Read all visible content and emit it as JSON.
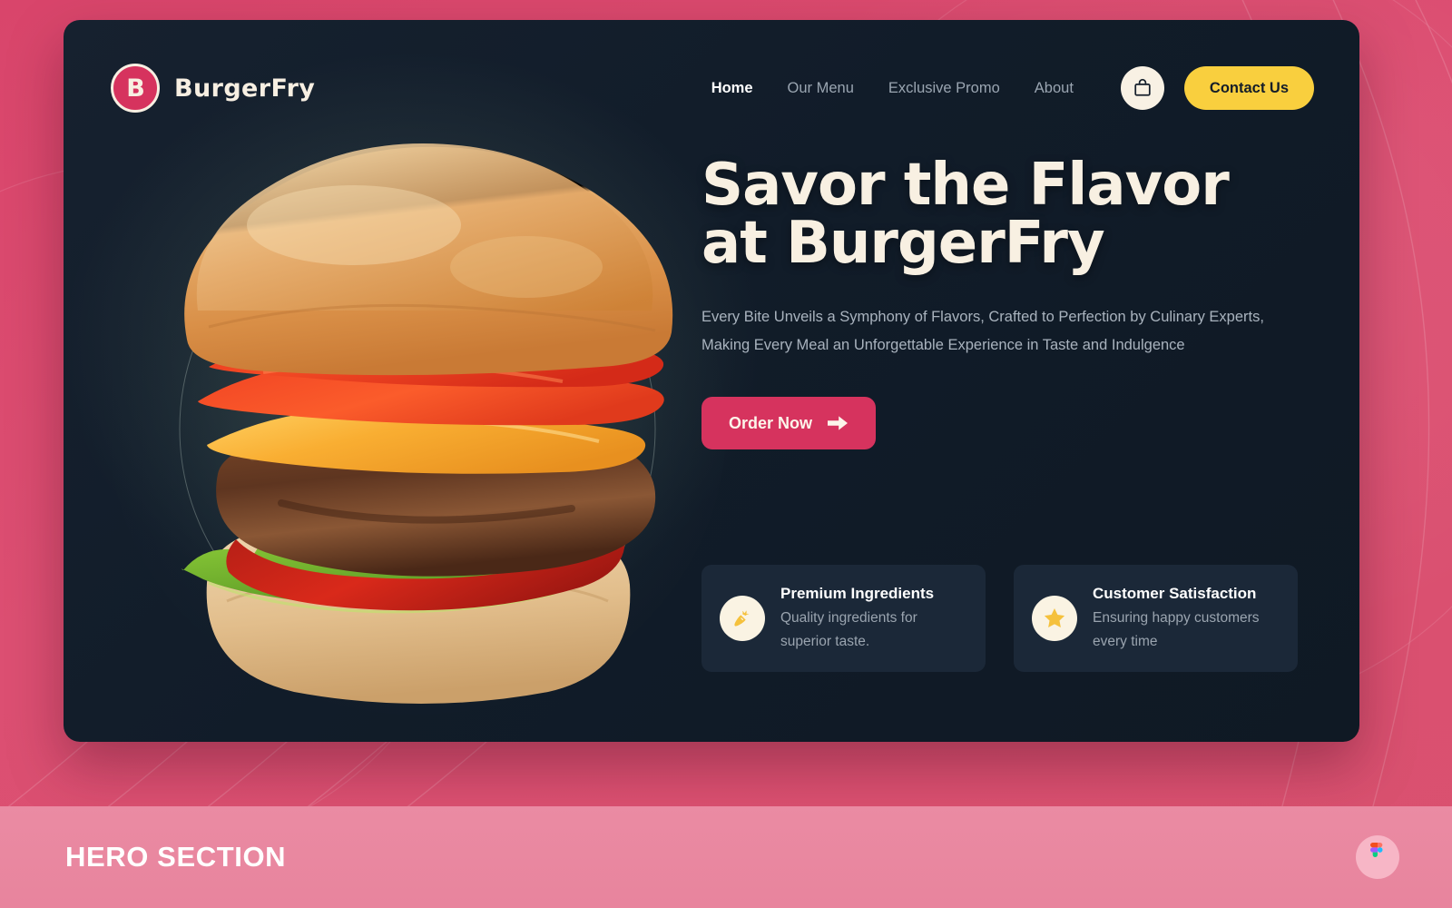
{
  "brand": {
    "badge_letter": "B",
    "name": "BurgerFry"
  },
  "nav": {
    "items": [
      {
        "label": "Home",
        "active": true
      },
      {
        "label": "Our Menu",
        "active": false
      },
      {
        "label": "Exclusive Promo",
        "active": false
      },
      {
        "label": "About",
        "active": false
      }
    ]
  },
  "header_actions": {
    "cart_icon": "shopping-bag-icon",
    "contact_label": "Contact Us"
  },
  "hero": {
    "title_line_1": "Savor the Flavor",
    "title_line_2": "at BurgerFry",
    "subtitle_line_1": "Every Bite Unveils a Symphony of Flavors, Crafted to Perfection by Culinary Experts,",
    "subtitle_line_2": "Making Every Meal an Unforgettable Experience in Taste and Indulgence",
    "cta_label": "Order Now",
    "cta_icon": "arrow-right-icon",
    "image_alt": "burger-photo"
  },
  "features": [
    {
      "icon": "carrot-icon",
      "title": "Premium Ingredients",
      "desc": "Quality ingredients for superior taste."
    },
    {
      "icon": "star-icon",
      "title": "Customer Satisfaction",
      "desc": "Ensuring happy customers every time"
    }
  ],
  "footer": {
    "section_label": "HERO SECTION",
    "badge_icon": "figma-logo-icon"
  },
  "colors": {
    "page_background": "#DC4F72",
    "hero_background": "#111C29",
    "card_background": "#1B2838",
    "accent_crimson": "#D6335E",
    "accent_yellow": "#F9CF3E",
    "cream": "#F8F0E2",
    "muted_text": "#9AA5B1",
    "footer_bar": "#E8849D"
  }
}
